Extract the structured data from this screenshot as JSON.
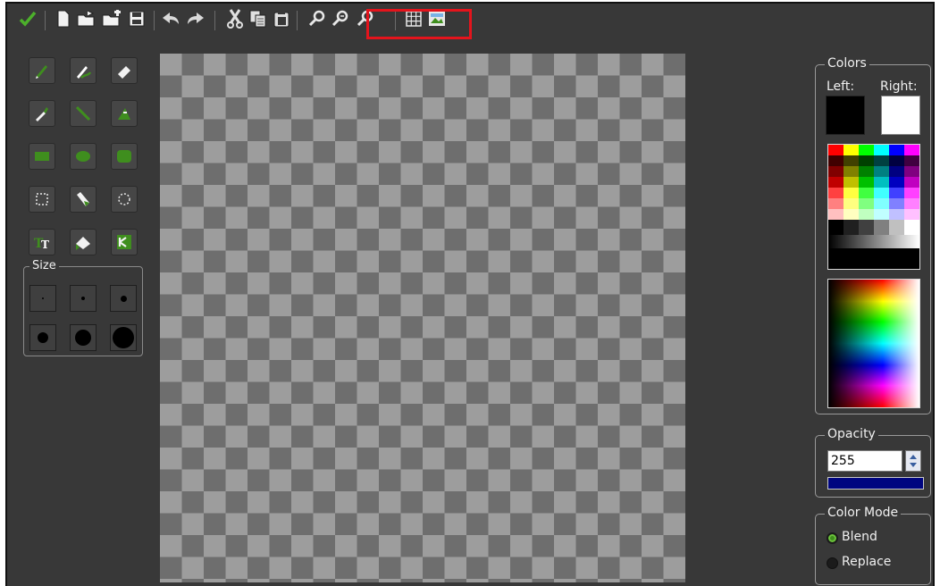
{
  "toolbar": {
    "icons": [
      "checkmark-icon",
      "new-file-icon",
      "open-file-icon",
      "open-folder-icon",
      "save-icon",
      "undo-icon",
      "redo-icon",
      "cut-icon",
      "copy-icon",
      "paste-icon",
      "zoom-in-icon",
      "zoom-reset-icon",
      "zoom-out-icon",
      "grid-icon",
      "image-icon"
    ]
  },
  "tools": [
    "pencil",
    "brush",
    "eraser",
    "color-picker",
    "line",
    "fill",
    "rectangle",
    "ellipse",
    "rounded-rectangle",
    "rectangle-select",
    "clone",
    "ellipse-select",
    "text",
    "flood-eraser",
    "crop"
  ],
  "size": {
    "legend": "Size",
    "levels": [
      1,
      2,
      3,
      4,
      5,
      6
    ]
  },
  "colors": {
    "legend": "Colors",
    "left_label": "Left:",
    "right_label": "Right:",
    "left_color": "#000000",
    "right_color": "#ffffff"
  },
  "opacity": {
    "legend": "Opacity",
    "value": "255",
    "bar_color": "#000580"
  },
  "color_mode": {
    "legend": "Color Mode",
    "options": [
      {
        "label": "Blend",
        "selected": true
      },
      {
        "label": "Replace",
        "selected": false
      }
    ]
  },
  "accent": "#3f8e1e",
  "highlight_color": "#e4141c"
}
